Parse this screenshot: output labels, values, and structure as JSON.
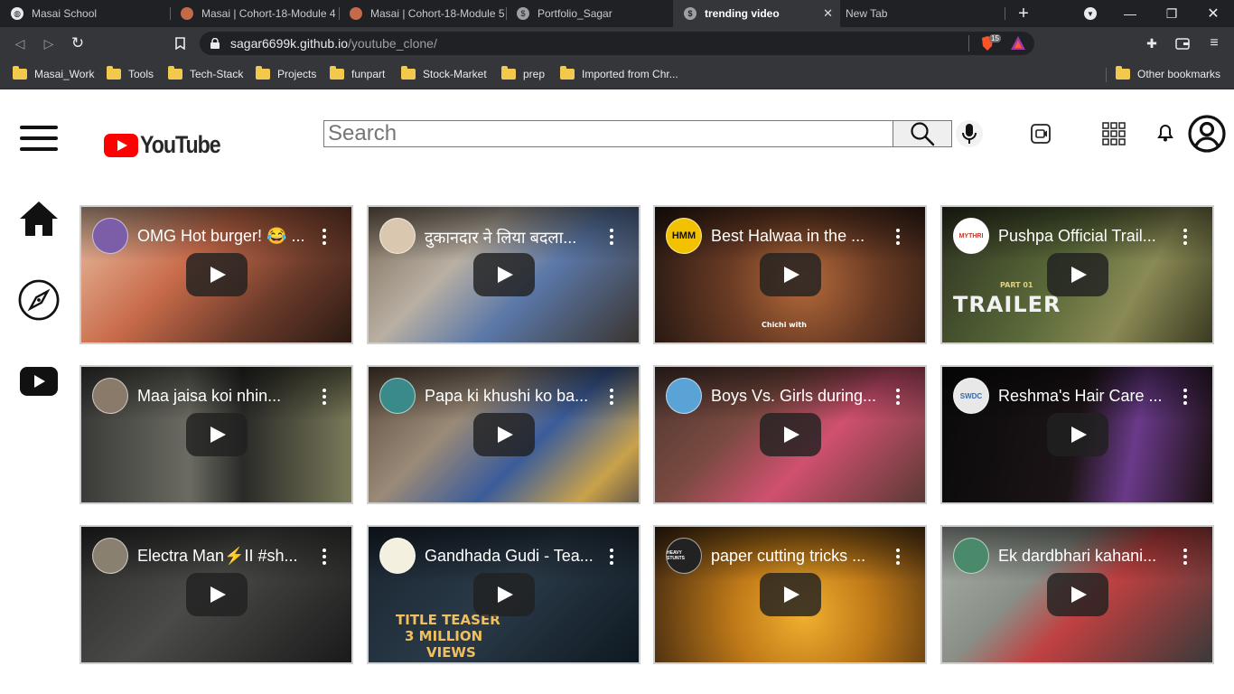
{
  "browser": {
    "tabs": [
      {
        "title": "Masai School",
        "active": false
      },
      {
        "title": "Masai | Cohort-18-Module 4",
        "active": false
      },
      {
        "title": "Masai | Cohort-18-Module 5",
        "active": false
      },
      {
        "title": "Portfolio_Sagar",
        "active": false
      },
      {
        "title": "trending video",
        "active": true
      },
      {
        "title": "New Tab",
        "active": false
      }
    ],
    "new_tab_label": "+",
    "url_host": "sagar6699k.github.io",
    "url_path": "/youtube_clone/",
    "brave_badge": "15",
    "bookmarks": [
      "Masai_Work",
      "Tools",
      "Tech-Stack",
      "Projects",
      "funpart",
      "Stock-Market",
      "prep",
      "Imported from Chr..."
    ],
    "other_bookmarks": "Other bookmarks"
  },
  "header": {
    "logo_text": "YouTube",
    "search_placeholder": "Search"
  },
  "videos": [
    {
      "title": "OMG Hot burger! 😂 ...",
      "avatar_color": "#7b5ea7",
      "thumb": "linear-gradient(135deg,#e9c3a7 0%,#c96b4a 40%,#6b3b2a 70%,#2a1a14 100%)"
    },
    {
      "title": "दुकानदार ने लिया बदला...",
      "avatar_color": "#d9c7b0",
      "thumb": "linear-gradient(135deg,#7a6a58 0%,#b9b0a3 35%,#5b78a8 60%,#3a3530 100%)"
    },
    {
      "title": "Best Halwaa in the ...",
      "avatar_color": "#f2c200",
      "thumb": "radial-gradient(circle at 55% 55%,#b46a3a 0%,#6a3b24 45%,#241712 100%)"
    },
    {
      "title": "Pushpa Official Trail...",
      "avatar_color": "#ffffff",
      "thumb": "linear-gradient(120deg,#2d3320 0%,#5b6a3a 45%,#8a8a55 70%,#3a3a22 100%)"
    },
    {
      "title": "Maa jaisa koi nhin...",
      "avatar_color": "#8a7a6a",
      "thumb": "linear-gradient(90deg,#3a3a38 0%,#6b6b62 40%,#2a2a28 60%,#7a7a5a 100%)"
    },
    {
      "title": "Papa ki khushi ko ba...",
      "avatar_color": "#3a8a8a",
      "thumb": "linear-gradient(135deg,#5a4a3a 0%,#9a8a78 35%,#3b5c9a 60%,#c9a24a 85%,#6a5a4a 100%)"
    },
    {
      "title": "Boys Vs. Girls during...",
      "avatar_color": "#5aa3d6",
      "thumb": "linear-gradient(135deg,#4a3530 0%,#7a4a40 35%,#d05070 60%,#5a3a34 100%)"
    },
    {
      "title": "Reshma's Hair Care ...",
      "avatar_color": "#e8e8e8",
      "thumb": "linear-gradient(100deg,#0a0a0a 0%,#1c1416 50%,#6a3a8a 70%,#1a1010 100%)"
    },
    {
      "title": "Electra Man⚡II #sh...",
      "avatar_color": "#8a8070",
      "thumb": "linear-gradient(135deg,#2a2a2a 0%,#4a4a48 45%,#1a1a1a 100%)"
    },
    {
      "title": "Gandhada Gudi - Tea...",
      "avatar_color": "#f4f0e0",
      "thumb": "linear-gradient(135deg,#1a2530 0%,#2a3a48 50%,#0e1820 100%)"
    },
    {
      "title": "paper cutting tricks ...",
      "avatar_color": "#222222",
      "thumb": "radial-gradient(circle at 55% 65%,#f0b030 0%,#c07a18 40%,#3a2410 100%)"
    },
    {
      "title": "Ek dardbhari kahani...",
      "avatar_color": "#4a8a6a",
      "thumb": "linear-gradient(135deg,#a9b0a8 0%,#8a9088 35%,#c04040 55%,#3a3a3a 100%)"
    }
  ],
  "thumb_text": {
    "halwa_caption": "Chichi with",
    "pushpa_caption": "TRAILER",
    "pushpa_small": "PART 01",
    "teaser_line1": "TITLE TEASER",
    "teaser_line2": "3 MILLION",
    "teaser_line3": "VIEWS",
    "avatar_halwa": "HMM",
    "avatar_pushpa": "MYTHRI",
    "avatar_reshma": "SWDC",
    "avatar_heavy": "HEAVY STUNTS"
  }
}
